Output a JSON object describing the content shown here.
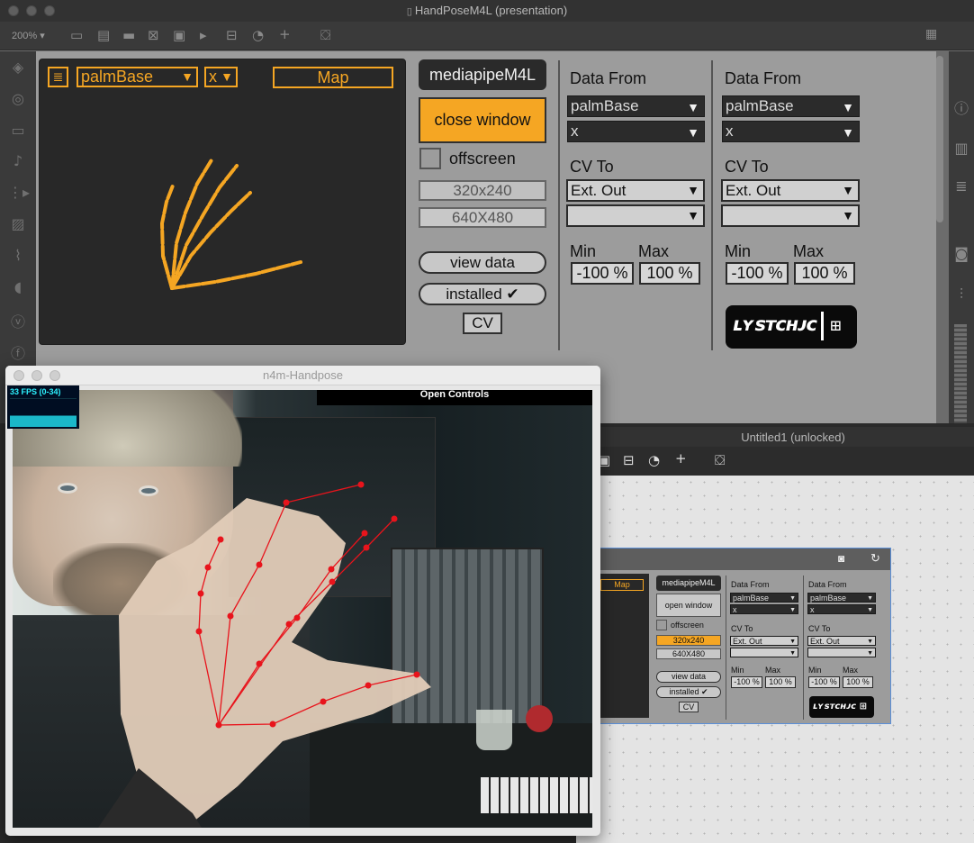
{
  "main_window": {
    "title": "HandPoseM4L (presentation)",
    "zoom": "200%",
    "toolbar_icons": [
      "presentation-icon",
      "text-icon",
      "comment-icon",
      "close-box-icon",
      "object-icon",
      "play-icon",
      "split-icon",
      "gauge-icon",
      "plus-icon",
      "paint-bucket-icon"
    ]
  },
  "sidebar_left_icons": [
    "cube-icon",
    "target-icon",
    "film-icon",
    "note-icon",
    "play-list-icon",
    "image-icon",
    "paperclip-icon",
    "plug-icon",
    "v-icon",
    "f-icon"
  ],
  "sidebar_right_icons": [
    "info-icon",
    "columns-icon",
    "list-icon",
    "camera-icon",
    "sliders-icon"
  ],
  "hand_panel": {
    "menu_icon": "hamburger-icon",
    "point_select": "palmBase",
    "axis_select": "x",
    "map_label": "Map"
  },
  "controls": {
    "title": "mediapipeM4L",
    "close_window": "close window",
    "offscreen": "offscreen",
    "res1": "320x240",
    "res2": "640X480",
    "view_data": "view data",
    "installed": "installed ✔",
    "cv": "CV"
  },
  "mappers": [
    {
      "data_from_label": "Data From",
      "point": "palmBase",
      "axis": "x",
      "cv_to_label": "CV To",
      "cv_dest": "Ext. Out",
      "cv_dest2": "",
      "min_label": "Min",
      "max_label": "Max",
      "min": "-100 %",
      "max": "100 %"
    },
    {
      "data_from_label": "Data From",
      "point": "palmBase",
      "axis": "x",
      "cv_to_label": "CV To",
      "cv_dest": "Ext. Out",
      "cv_dest2": "",
      "min_label": "Min",
      "max_label": "Max",
      "min": "-100 %",
      "max": "100 %"
    }
  ],
  "logo_text": "LYSTCHJC",
  "camera_window": {
    "title": "n4m-Handpose",
    "fps": "33 FPS (0-34)",
    "open_controls": "Open Controls"
  },
  "untitled_window": {
    "title": "Untitled1 (unlocked)",
    "embedded": {
      "map": "Map",
      "title": "mediapipeM4L",
      "open_window": "open window",
      "offscreen": "offscreen",
      "res1": "320x240",
      "res2": "640X480",
      "view_data": "view data",
      "installed": "installed ✔",
      "cv": "CV",
      "mappers": [
        {
          "data_from": "Data From",
          "point": "palmBase",
          "axis": "x",
          "cv_to": "CV To",
          "dest": "Ext. Out",
          "min_label": "Min",
          "max_label": "Max",
          "min": "-100 %",
          "max": "100 %"
        },
        {
          "data_from": "Data From",
          "point": "palmBase",
          "axis": "x",
          "cv_to": "CV To",
          "dest": "Ext. Out",
          "min_label": "Min",
          "max_label": "Max",
          "min": "-100 %",
          "max": "100 %"
        }
      ]
    }
  },
  "colors": {
    "accent": "#f5a623",
    "panel_bg": "#9b9b9b",
    "dark_panel": "#282828",
    "landmark_red": "#e8141c"
  }
}
